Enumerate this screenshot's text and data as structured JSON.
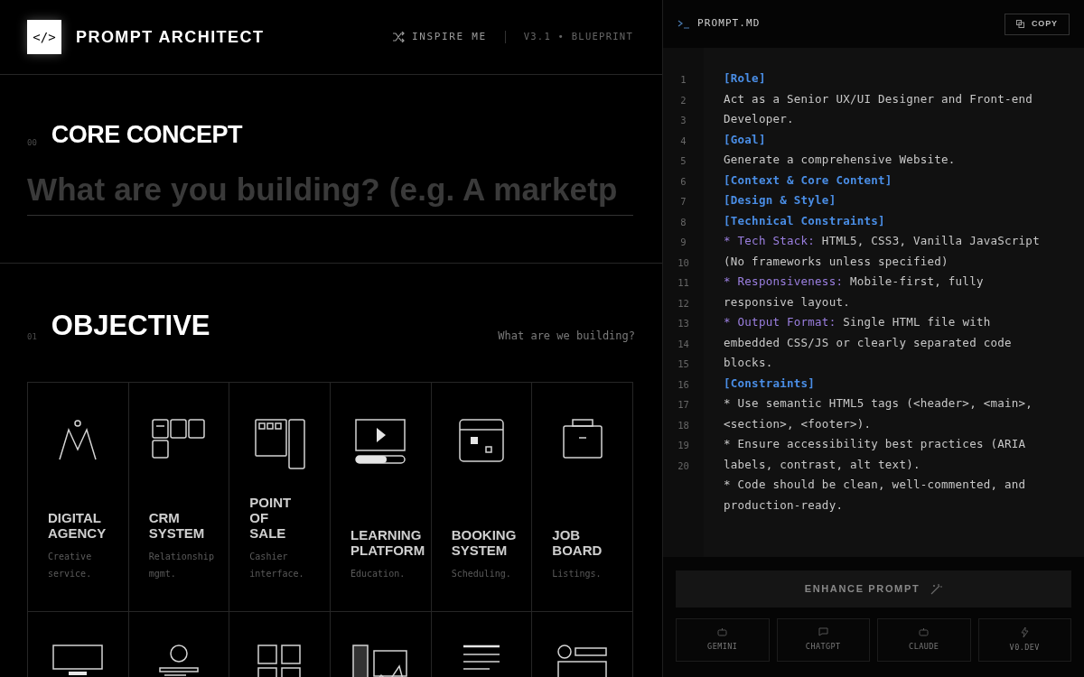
{
  "header": {
    "logo": "</>",
    "title": "PROMPT ARCHITECT",
    "inspire": "INSPIRE ME",
    "version": "V3.1 • BLUEPRINT"
  },
  "core": {
    "number": "00",
    "title": "CORE CONCEPT",
    "placeholder": "What are you building? (e.g. A marketp"
  },
  "objective": {
    "number": "01",
    "title": "OBJECTIVE",
    "hint": "What are we building?",
    "cards": [
      {
        "kind": "full",
        "title": [
          "DIGITAL",
          "AGENCY"
        ],
        "desc": "Creative service."
      },
      {
        "kind": "full",
        "title": [
          "CRM",
          "SYSTEM"
        ],
        "desc": "Relationship mgmt."
      },
      {
        "kind": "full",
        "title": [
          "POINT",
          "OF",
          "SALE"
        ],
        "desc": "Cashier interface."
      },
      {
        "kind": "full",
        "title": [
          "LEARNING",
          "PLATFORM"
        ],
        "desc": "Education."
      },
      {
        "kind": "full",
        "title": [
          "BOOKING",
          "SYSTEM"
        ],
        "desc": "Scheduling."
      },
      {
        "kind": "full",
        "title": [
          "JOB",
          "BOARD"
        ],
        "desc": "Listings."
      },
      {
        "kind": "cut"
      },
      {
        "kind": "cut"
      },
      {
        "kind": "cut"
      },
      {
        "kind": "cut"
      },
      {
        "kind": "cut"
      },
      {
        "kind": "cut"
      }
    ]
  },
  "editor": {
    "filename": "PROMPT.MD",
    "copy": "COPY",
    "line_numbers": [
      "1",
      "2",
      "3",
      "4",
      "5",
      "6",
      "7",
      "8",
      "9",
      "10",
      "11",
      "12",
      "13",
      "14",
      "15",
      "16",
      "17",
      "18",
      "19",
      "20"
    ],
    "lines": [
      {
        "kind": "heading",
        "text": "[Role]"
      },
      {
        "kind": "text",
        "text": "Act as a Senior UX/UI Designer and Front-end"
      },
      {
        "kind": "text",
        "text": "Developer."
      },
      {
        "kind": "heading",
        "text": "[Goal]"
      },
      {
        "kind": "text",
        "text": "Generate a comprehensive Website."
      },
      {
        "kind": "heading",
        "text": "[Context & Core Content]"
      },
      {
        "kind": "heading",
        "text": "[Design & Style]"
      },
      {
        "kind": "heading",
        "text": "[Technical Constraints]"
      },
      {
        "kind": "item",
        "key": "* Tech Stack:",
        "text": "HTML5, CSS3, Vanilla JavaScript"
      },
      {
        "kind": "text",
        "text": "(No frameworks unless specified)"
      },
      {
        "kind": "item",
        "key": "* Responsiveness:",
        "text": "Mobile-first, fully"
      },
      {
        "kind": "text",
        "text": "responsive layout."
      },
      {
        "kind": "item",
        "key": "* Output Format:",
        "text": "Single HTML file with"
      },
      {
        "kind": "text",
        "text": "embedded CSS/JS or clearly separated code"
      },
      {
        "kind": "text",
        "text": "blocks."
      },
      {
        "kind": "heading",
        "text": "[Constraints]"
      },
      {
        "kind": "text",
        "text": "* Use semantic HTML5 tags (<header>, <main>,"
      },
      {
        "kind": "text",
        "text": "<section>, <footer>)."
      },
      {
        "kind": "text",
        "text": "* Ensure accessibility best practices (ARIA"
      },
      {
        "kind": "text",
        "text": "labels, contrast, alt text)."
      },
      {
        "kind": "text",
        "text": "* Code should be clean, well-commented, and"
      },
      {
        "kind": "text",
        "text": "production-ready."
      }
    ]
  },
  "footer": {
    "enhance": "ENHANCE PROMPT",
    "targets": [
      "GEMINI",
      "CHATGPT",
      "CLAUDE",
      "V0.DEV"
    ]
  }
}
